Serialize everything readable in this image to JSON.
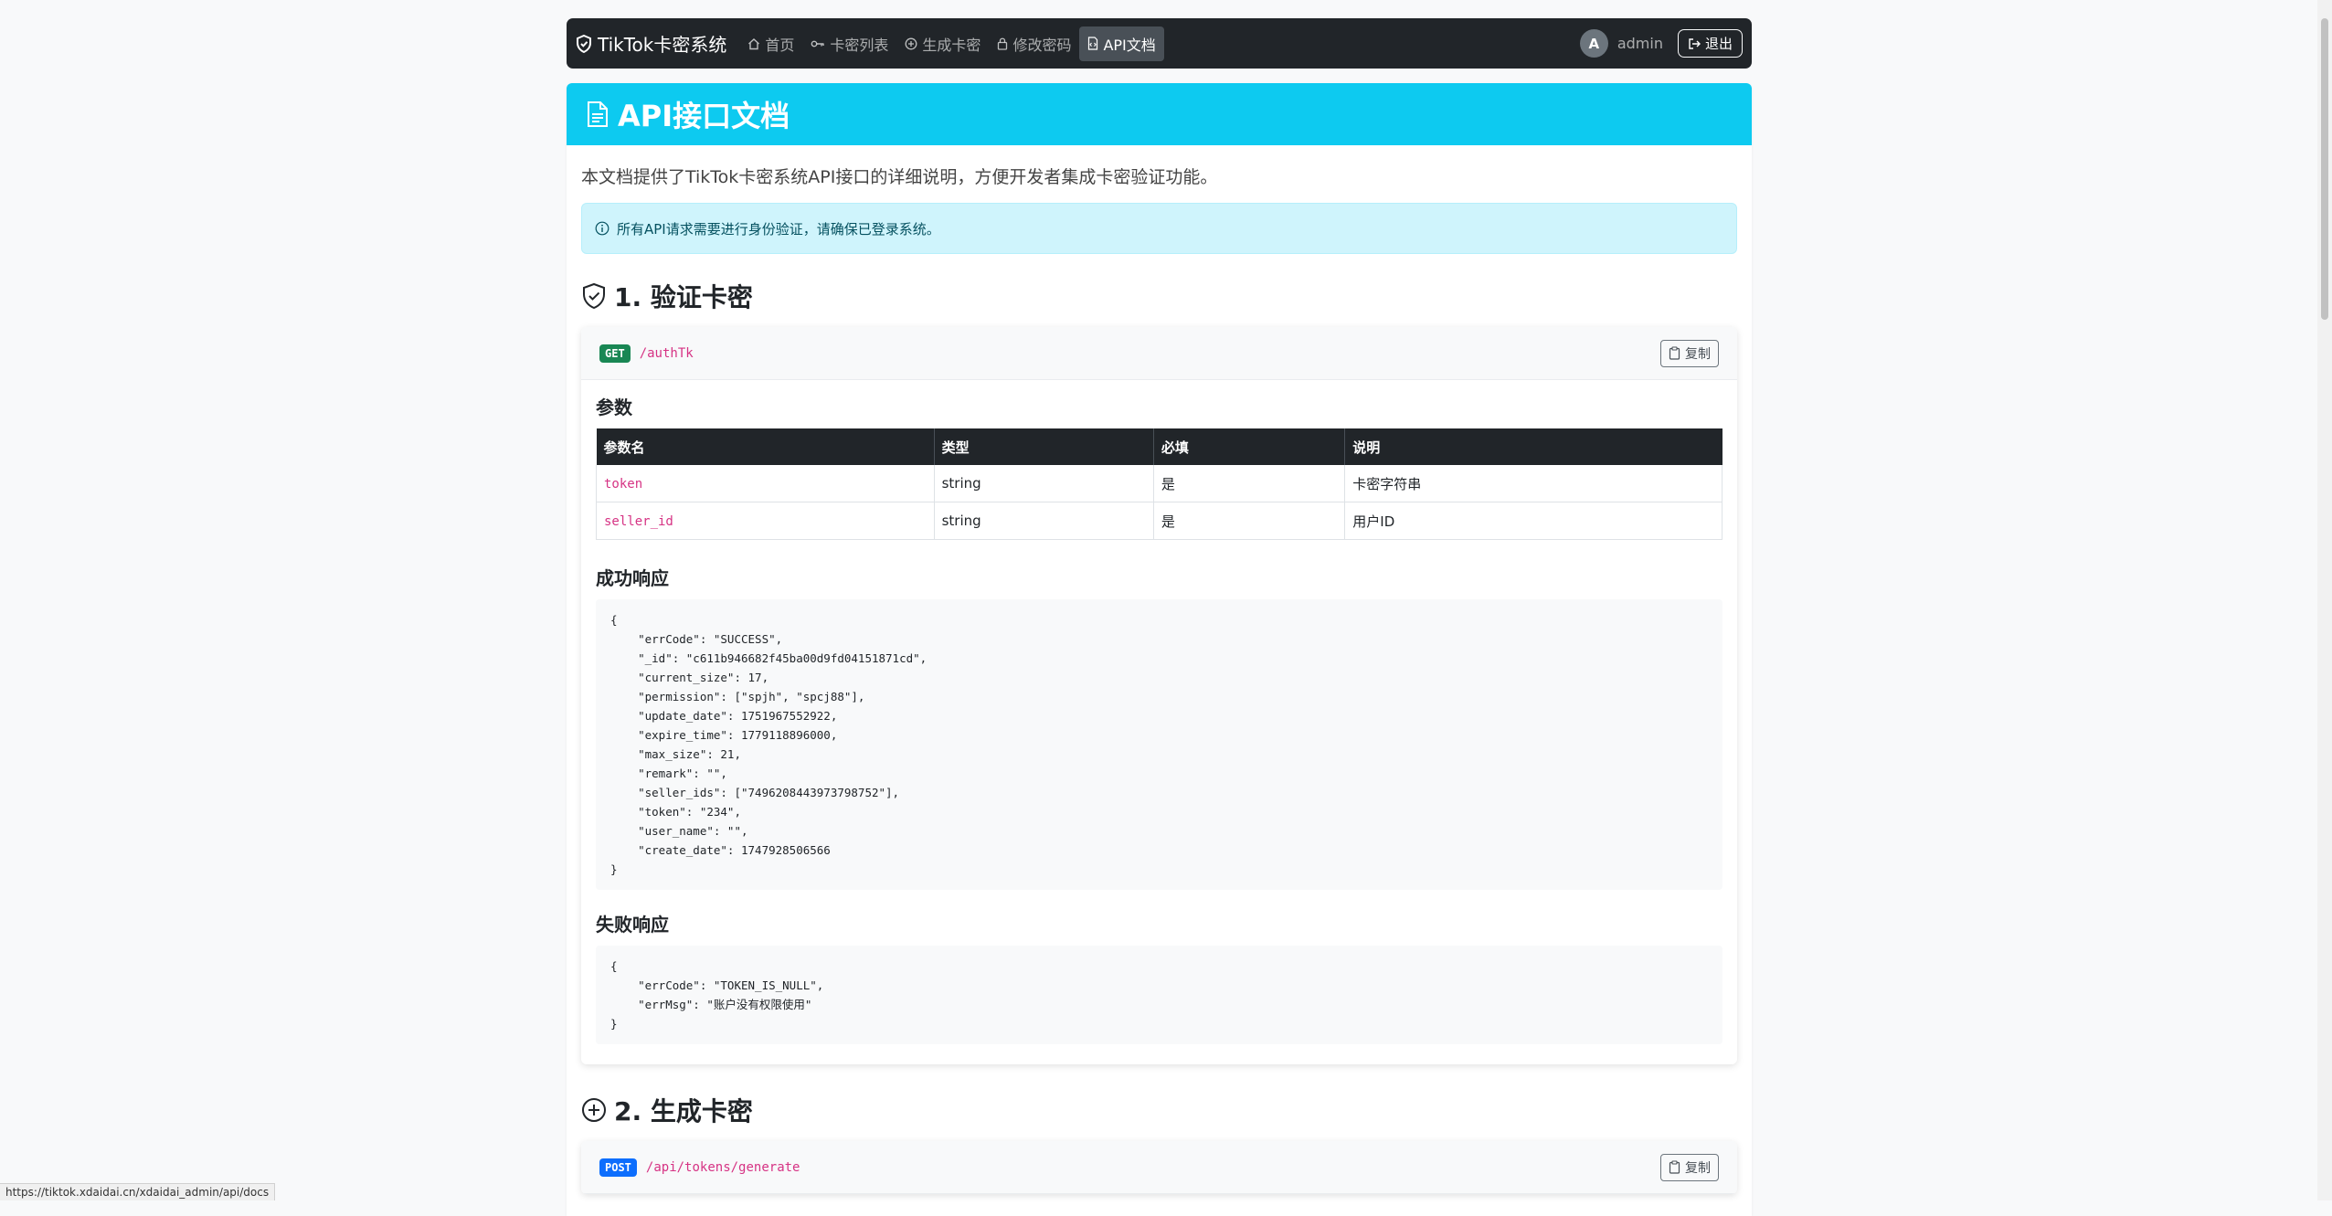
{
  "navbar": {
    "brand": "TikTok卡密系统",
    "items": [
      {
        "label": "首页"
      },
      {
        "label": "卡密列表"
      },
      {
        "label": "生成卡密"
      },
      {
        "label": "修改密码"
      },
      {
        "label": "API文档",
        "active": true
      }
    ],
    "avatar_letter": "A",
    "user": "admin",
    "logout": "退出"
  },
  "page": {
    "title": "API接口文档",
    "intro": "本文档提供了TikTok卡密系统API接口的详细说明，方便开发者集成卡密验证功能。",
    "alert": "所有API请求需要进行身份验证，请确保已登录系统。"
  },
  "section1": {
    "title": "1. 验证卡密",
    "method": "GET",
    "path": "/authTk",
    "copy": "复制",
    "params_title": "参数",
    "columns": [
      "参数名",
      "类型",
      "必填",
      "说明"
    ],
    "rows": [
      {
        "name": "token",
        "type": "string",
        "required": "是",
        "desc": "卡密字符串"
      },
      {
        "name": "seller_id",
        "type": "string",
        "required": "是",
        "desc": "用户ID"
      }
    ],
    "success_title": "成功响应",
    "success_code": "{\n    \"errCode\": \"SUCCESS\",\n    \"_id\": \"c611b946682f45ba00d9fd04151871cd\",\n    \"current_size\": 17,\n    \"permission\": [\"spjh\", \"spcj88\"],\n    \"update_date\": 1751967552922,\n    \"expire_time\": 1779118896000,\n    \"max_size\": 21,\n    \"remark\": \"\",\n    \"seller_ids\": [\"7496208443973798752\"],\n    \"token\": \"234\",\n    \"user_name\": \"\",\n    \"create_date\": 1747928506566\n}",
    "fail_title": "失败响应",
    "fail_code": "{\n    \"errCode\": \"TOKEN_IS_NULL\",\n    \"errMsg\": \"账户没有权限使用\"\n}"
  },
  "section2": {
    "title": "2. 生成卡密",
    "method": "POST",
    "path": "/api/tokens/generate",
    "copy": "复制"
  },
  "status_url": "https://tiktok.xdaidai.cn/xdaidai_admin/api/docs",
  "colors": {
    "navbar": "#212529",
    "header": "#0dcaf0",
    "get": "#198754",
    "post": "#0d6efd",
    "code_name": "#d63384"
  }
}
